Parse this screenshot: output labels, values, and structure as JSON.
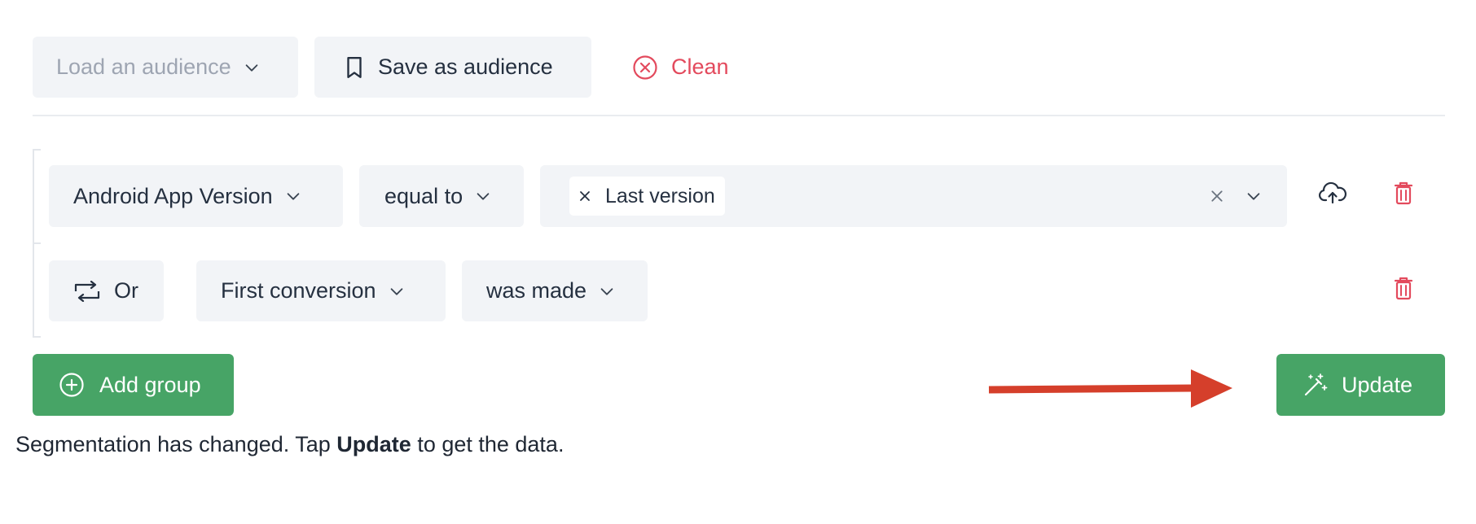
{
  "toolbar": {
    "load_audience_placeholder": "Load an audience",
    "save_audience_label": "Save as audience",
    "clean_label": "Clean"
  },
  "group": {
    "condition_1": {
      "property": "Android App Version",
      "operator": "equal to",
      "values": [
        "Last version"
      ]
    },
    "condition_2": {
      "connector": "Or",
      "event": "First conversion",
      "state": "was made"
    }
  },
  "actions": {
    "add_group_label": "Add group",
    "update_label": "Update"
  },
  "message": {
    "prefix": "Segmentation has changed. Tap ",
    "bold": "Update",
    "suffix": " to get the data."
  },
  "colors": {
    "accent_green": "#47a466",
    "danger_red": "#e34a5d",
    "annotation_arrow": "#d53f2b",
    "control_bg": "#f2f4f7"
  },
  "icons": {
    "chevron": "chevron-down-icon",
    "bookmark": "bookmark-icon",
    "clean": "circle-x-icon",
    "remove_tag": "x-icon",
    "clear_all": "x-icon",
    "cloud": "cloud-upload-icon",
    "delete": "trash-icon",
    "repeat": "repeat-icon",
    "add": "plus-circle-icon",
    "update": "magic-wand-icon",
    "annotation": "arrow-right-icon"
  }
}
